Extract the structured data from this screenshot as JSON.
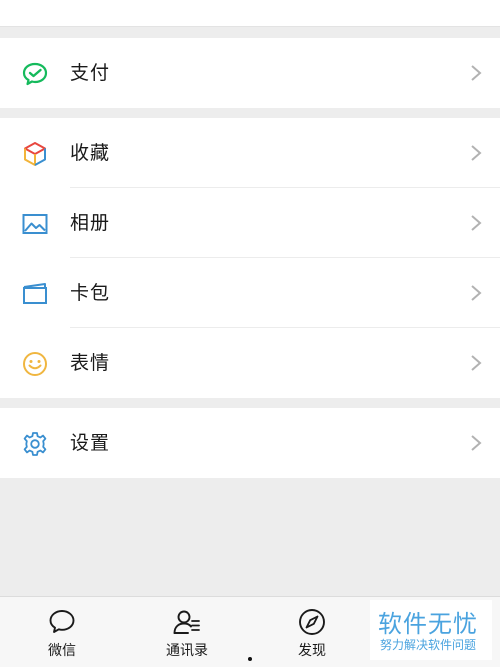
{
  "groups": [
    {
      "items": [
        {
          "label": "支付",
          "icon": "wechat-pay-icon"
        }
      ]
    },
    {
      "items": [
        {
          "label": "收藏",
          "icon": "favorites-cube-icon"
        },
        {
          "label": "相册",
          "icon": "album-image-icon"
        },
        {
          "label": "卡包",
          "icon": "card-wallet-icon"
        },
        {
          "label": "表情",
          "icon": "smiley-face-icon"
        }
      ]
    },
    {
      "items": [
        {
          "label": "设置",
          "icon": "gear-icon"
        }
      ]
    }
  ],
  "tabbar": {
    "items": [
      {
        "label": "微信",
        "icon": "chat-bubble-icon"
      },
      {
        "label": "通讯录",
        "icon": "contacts-icon"
      },
      {
        "label": "发现",
        "icon": "compass-icon"
      }
    ]
  },
  "watermark": {
    "title": "软件无忧",
    "subtitle": "努力解决软件问题"
  },
  "colors": {
    "pay_green": "#15ba5c",
    "accent_blue": "#3a8fd0",
    "smiley_yellow": "#f0b640",
    "background": "#ededed"
  }
}
